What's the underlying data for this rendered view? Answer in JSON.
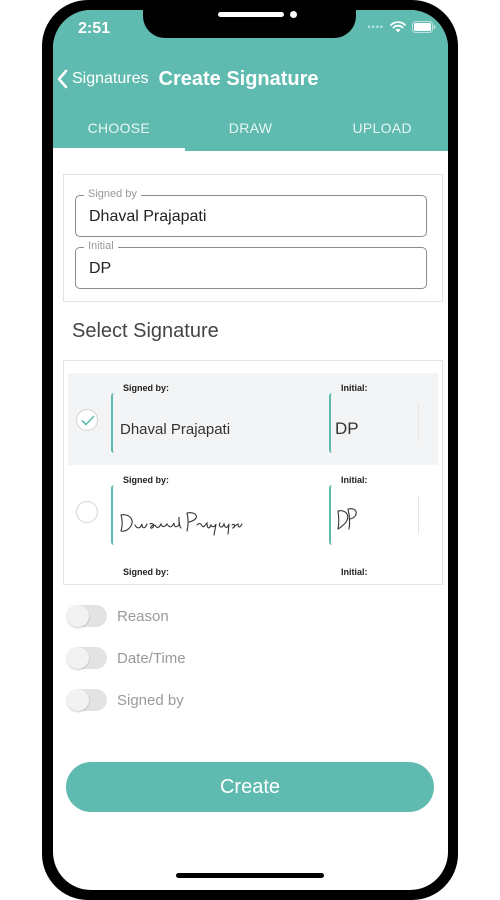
{
  "status": {
    "time": "2:51",
    "signal_dots": "••••"
  },
  "nav": {
    "back_label": "Signatures",
    "title": "Create Signature"
  },
  "tabs": [
    {
      "label": "CHOOSE",
      "active": true
    },
    {
      "label": "DRAW",
      "active": false
    },
    {
      "label": "UPLOAD",
      "active": false
    }
  ],
  "form": {
    "signed_by": {
      "legend": "Signed by",
      "value": "Dhaval Prajapati"
    },
    "initial": {
      "legend": "Initial",
      "value": "DP"
    }
  },
  "select_title": "Select Signature",
  "signatures": [
    {
      "signed_caption": "Signed by:",
      "signed_value": "Dhaval Prajapati",
      "initial_caption": "Initial:",
      "initial_value": "DP",
      "selected": true,
      "style": "typed"
    },
    {
      "signed_caption": "Signed by:",
      "signed_value": "Dhaval Prajapati",
      "initial_caption": "Initial:",
      "initial_value": "DP",
      "selected": false,
      "style": "handwritten"
    },
    {
      "signed_caption": "Signed by:",
      "initial_caption": "Initial:"
    }
  ],
  "toggles": [
    {
      "label": "Reason",
      "on": false
    },
    {
      "label": "Date/Time",
      "on": false
    },
    {
      "label": "Signed by",
      "on": false
    }
  ],
  "create_label": "Create",
  "colors": {
    "accent": "#5fbaaf",
    "selected_row": "#f2f4f5",
    "toggle_off": "#e3e3e3"
  }
}
